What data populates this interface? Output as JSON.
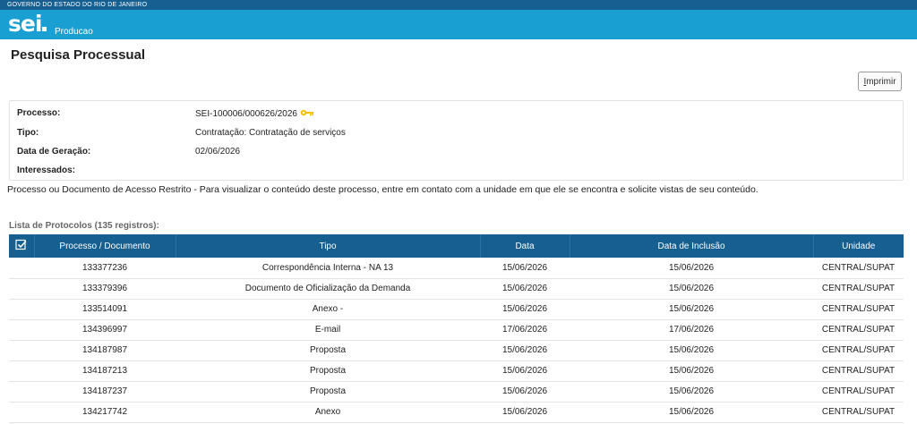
{
  "gov_bar": {
    "text": "GOVERNO DO ESTADO DO RIO DE JANEIRO"
  },
  "header": {
    "logo": "sei",
    "environment": "Producao"
  },
  "page": {
    "title": "Pesquisa Processual"
  },
  "toolbar": {
    "print_label_accesskey": "I",
    "print_label_rest": "mprimir"
  },
  "info": {
    "processo_label": "Processo:",
    "processo_value": "SEI-100006/000626/2026",
    "tipo_label": "Tipo:",
    "tipo_value": "Contratação: Contratação de serviços",
    "data_label": "Data de Geração:",
    "data_value": "02/06/2026",
    "interessados_label": "Interessados:",
    "interessados_value": ""
  },
  "restriction_message": "Processo ou Documento de Acesso Restrito - Para visualizar o conteúdo deste processo, entre em contato com a unidade em que ele se encontra e solicite vistas de seu conteúdo.",
  "protocols": {
    "caption": "Lista de Protocolos (135 registros):",
    "columns": {
      "processo": "Processo / Documento",
      "tipo": "Tipo",
      "data": "Data",
      "inclusao": "Data de Inclusão",
      "unidade": "Unidade"
    },
    "rows": [
      {
        "processo": "133377236",
        "tipo": "Correspondência Interna - NA 13",
        "data": "15/06/2026",
        "inclusao": "15/06/2026",
        "unidade": "CENTRAL/SUPAT"
      },
      {
        "processo": "133379396",
        "tipo": "Documento de Oficialização da Demanda",
        "data": "15/06/2026",
        "inclusao": "15/06/2026",
        "unidade": "CENTRAL/SUPAT"
      },
      {
        "processo": "133514091",
        "tipo": "Anexo -",
        "data": "15/06/2026",
        "inclusao": "15/06/2026",
        "unidade": "CENTRAL/SUPAT"
      },
      {
        "processo": "134396997",
        "tipo": "E-mail",
        "data": "17/06/2026",
        "inclusao": "17/06/2026",
        "unidade": "CENTRAL/SUPAT"
      },
      {
        "processo": "134187987",
        "tipo": "Proposta",
        "data": "15/06/2026",
        "inclusao": "15/06/2026",
        "unidade": "CENTRAL/SUPAT"
      },
      {
        "processo": "134187213",
        "tipo": "Proposta",
        "data": "15/06/2026",
        "inclusao": "15/06/2026",
        "unidade": "CENTRAL/SUPAT"
      },
      {
        "processo": "134187237",
        "tipo": "Proposta",
        "data": "15/06/2026",
        "inclusao": "15/06/2026",
        "unidade": "CENTRAL/SUPAT"
      },
      {
        "processo": "134217742",
        "tipo": "Anexo",
        "data": "15/06/2026",
        "inclusao": "15/06/2026",
        "unidade": "CENTRAL/SUPAT"
      }
    ]
  },
  "colors": {
    "gov_bar": "#155f91",
    "header": "#1a9fd3",
    "table_header": "#155f91",
    "key_icon": "#f2c200"
  },
  "icons": {
    "key": "key-icon",
    "select_all": "checkbox-check-icon"
  }
}
